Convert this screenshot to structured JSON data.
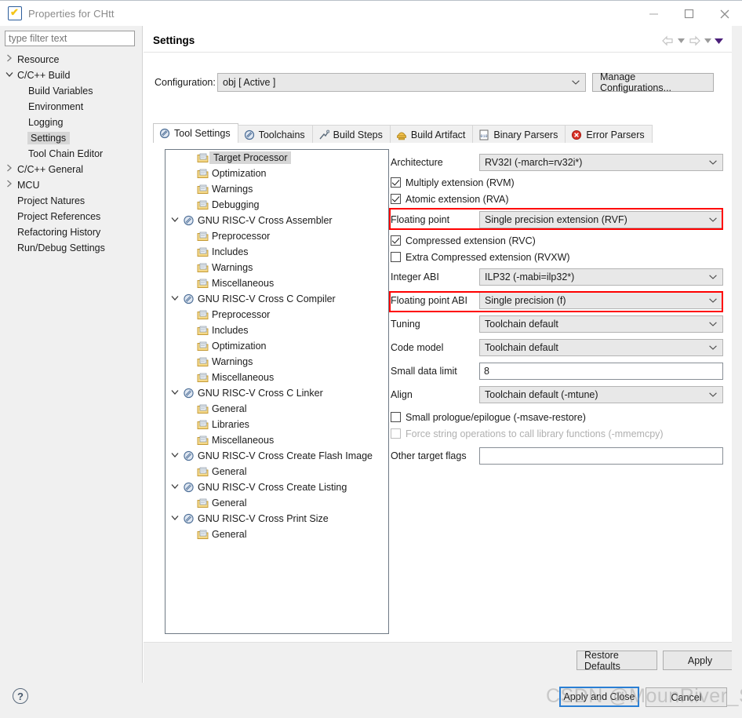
{
  "window": {
    "title": "Properties for CHtt",
    "icon": "properties-app-icon",
    "controls": {
      "minimize": "minimize-icon",
      "maximize": "maximize-icon",
      "close": "close-icon"
    }
  },
  "sidebar": {
    "filter_placeholder": "type filter text",
    "filter_value": "",
    "items": [
      {
        "label": "Resource",
        "level": 0,
        "arrow": "collapsed",
        "selected": false
      },
      {
        "label": "C/C++ Build",
        "level": 0,
        "arrow": "expanded",
        "selected": false
      },
      {
        "label": "Build Variables",
        "level": 1,
        "arrow": "none",
        "selected": false
      },
      {
        "label": "Environment",
        "level": 1,
        "arrow": "none",
        "selected": false
      },
      {
        "label": "Logging",
        "level": 1,
        "arrow": "none",
        "selected": false
      },
      {
        "label": "Settings",
        "level": 1,
        "arrow": "none",
        "selected": true
      },
      {
        "label": "Tool Chain Editor",
        "level": 1,
        "arrow": "none",
        "selected": false
      },
      {
        "label": "C/C++ General",
        "level": 0,
        "arrow": "collapsed",
        "selected": false
      },
      {
        "label": "MCU",
        "level": 0,
        "arrow": "collapsed",
        "selected": false
      },
      {
        "label": "Project Natures",
        "level": 0,
        "arrow": "none",
        "selected": false
      },
      {
        "label": "Project References",
        "level": 0,
        "arrow": "none",
        "selected": false
      },
      {
        "label": "Refactoring History",
        "level": 0,
        "arrow": "none",
        "selected": false
      },
      {
        "label": "Run/Debug Settings",
        "level": 0,
        "arrow": "none",
        "selected": false
      }
    ]
  },
  "header": {
    "title": "Settings",
    "nav_back": "back-arrow-icon",
    "nav_back_caret": "chevron-down-icon",
    "nav_forward": "forward-arrow-icon",
    "nav_forward_caret": "chevron-down-icon",
    "menu_caret": "view-menu-icon"
  },
  "configuration": {
    "label": "Configuration:",
    "value": "obj  [ Active ]",
    "manage_button": "Manage Configurations..."
  },
  "tabs": [
    {
      "label": "Tool Settings",
      "icon": "tool-settings-icon",
      "active": true
    },
    {
      "label": "Toolchains",
      "icon": "toolchains-icon",
      "active": false
    },
    {
      "label": "Build Steps",
      "icon": "build-steps-icon",
      "active": false
    },
    {
      "label": "Build Artifact",
      "icon": "build-artifact-icon",
      "active": false
    },
    {
      "label": "Binary Parsers",
      "icon": "binary-parsers-icon",
      "active": false
    },
    {
      "label": "Error Parsers",
      "icon": "error-parsers-icon",
      "active": false
    }
  ],
  "tool_tree": [
    {
      "label": "Target Processor",
      "indent": 1,
      "arrow": "none",
      "icon": "folder-page-icon",
      "selected": true
    },
    {
      "label": "Optimization",
      "indent": 1,
      "arrow": "none",
      "icon": "folder-page-icon",
      "selected": false
    },
    {
      "label": "Warnings",
      "indent": 1,
      "arrow": "none",
      "icon": "folder-page-icon",
      "selected": false
    },
    {
      "label": "Debugging",
      "indent": 1,
      "arrow": "none",
      "icon": "folder-page-icon",
      "selected": false
    },
    {
      "label": "GNU RISC-V Cross Assembler",
      "indent": 0,
      "arrow": "expanded",
      "icon": "toolchain-icon",
      "selected": false
    },
    {
      "label": "Preprocessor",
      "indent": 1,
      "arrow": "none",
      "icon": "folder-page-icon",
      "selected": false
    },
    {
      "label": "Includes",
      "indent": 1,
      "arrow": "none",
      "icon": "folder-page-icon",
      "selected": false
    },
    {
      "label": "Warnings",
      "indent": 1,
      "arrow": "none",
      "icon": "folder-page-icon",
      "selected": false
    },
    {
      "label": "Miscellaneous",
      "indent": 1,
      "arrow": "none",
      "icon": "folder-page-icon",
      "selected": false
    },
    {
      "label": "GNU RISC-V Cross C Compiler",
      "indent": 0,
      "arrow": "expanded",
      "icon": "toolchain-icon",
      "selected": false
    },
    {
      "label": "Preprocessor",
      "indent": 1,
      "arrow": "none",
      "icon": "folder-page-icon",
      "selected": false
    },
    {
      "label": "Includes",
      "indent": 1,
      "arrow": "none",
      "icon": "folder-page-icon",
      "selected": false
    },
    {
      "label": "Optimization",
      "indent": 1,
      "arrow": "none",
      "icon": "folder-page-icon",
      "selected": false
    },
    {
      "label": "Warnings",
      "indent": 1,
      "arrow": "none",
      "icon": "folder-page-icon",
      "selected": false
    },
    {
      "label": "Miscellaneous",
      "indent": 1,
      "arrow": "none",
      "icon": "folder-page-icon",
      "selected": false
    },
    {
      "label": "GNU RISC-V Cross C Linker",
      "indent": 0,
      "arrow": "expanded",
      "icon": "toolchain-icon",
      "selected": false
    },
    {
      "label": "General",
      "indent": 1,
      "arrow": "none",
      "icon": "folder-page-icon",
      "selected": false
    },
    {
      "label": "Libraries",
      "indent": 1,
      "arrow": "none",
      "icon": "folder-page-icon",
      "selected": false
    },
    {
      "label": "Miscellaneous",
      "indent": 1,
      "arrow": "none",
      "icon": "folder-page-icon",
      "selected": false
    },
    {
      "label": "GNU RISC-V Cross Create Flash Image",
      "indent": 0,
      "arrow": "expanded",
      "icon": "toolchain-icon",
      "selected": false
    },
    {
      "label": "General",
      "indent": 1,
      "arrow": "none",
      "icon": "folder-page-icon",
      "selected": false
    },
    {
      "label": "GNU RISC-V Cross Create Listing",
      "indent": 0,
      "arrow": "expanded",
      "icon": "toolchain-icon",
      "selected": false
    },
    {
      "label": "General",
      "indent": 1,
      "arrow": "none",
      "icon": "folder-page-icon",
      "selected": false
    },
    {
      "label": "GNU RISC-V Cross Print Size",
      "indent": 0,
      "arrow": "expanded",
      "icon": "toolchain-icon",
      "selected": false
    },
    {
      "label": "General",
      "indent": 1,
      "arrow": "none",
      "icon": "folder-page-icon",
      "selected": false
    }
  ],
  "settings": {
    "architecture": {
      "label": "Architecture",
      "value": "RV32I (-march=rv32i*)",
      "type": "combo"
    },
    "multiply_extension": {
      "label": "Multiply extension (RVM)",
      "checked": true,
      "enabled": true
    },
    "atomic_extension": {
      "label": "Atomic extension (RVA)",
      "checked": true,
      "enabled": true
    },
    "floating_point": {
      "label": "Floating point",
      "value": "Single precision extension (RVF)",
      "type": "combo",
      "highlighted": true
    },
    "compressed_extension": {
      "label": "Compressed extension (RVC)",
      "checked": true,
      "enabled": true
    },
    "extra_compressed_extension": {
      "label": "Extra Compressed extension (RVXW)",
      "checked": false,
      "enabled": true
    },
    "integer_abi": {
      "label": "Integer ABI",
      "value": "ILP32 (-mabi=ilp32*)",
      "type": "combo"
    },
    "floating_point_abi": {
      "label": "Floating point ABI",
      "value": "Single precision (f)",
      "type": "combo",
      "highlighted": true
    },
    "tuning": {
      "label": "Tuning",
      "value": "Toolchain default",
      "type": "combo"
    },
    "code_model": {
      "label": "Code model",
      "value": "Toolchain default",
      "type": "combo"
    },
    "small_data_limit": {
      "label": "Small data limit",
      "value": "8",
      "type": "text"
    },
    "align": {
      "label": "Align",
      "value": "Toolchain default (-mtune)",
      "type": "combo"
    },
    "small_prologue": {
      "label": "Small prologue/epilogue (-msave-restore)",
      "checked": false,
      "enabled": true
    },
    "force_string_ops": {
      "label": "Force string operations to call library functions (-mmemcpy)",
      "checked": false,
      "enabled": false
    },
    "other_target_flags": {
      "label": "Other target flags",
      "value": "",
      "type": "text"
    }
  },
  "buttons": {
    "restore_defaults": "Restore Defaults",
    "apply": "Apply",
    "apply_and_close": "Apply and Close",
    "cancel": "Cancel",
    "help": "?"
  },
  "watermark": "CSDN @MounRiver_Studio",
  "colors": {
    "highlight_red": "#ff0000",
    "focus_blue": "#2a7fd4",
    "selection_gray": "#d6d6d6",
    "chrome_gray": "#f0f0f0"
  }
}
